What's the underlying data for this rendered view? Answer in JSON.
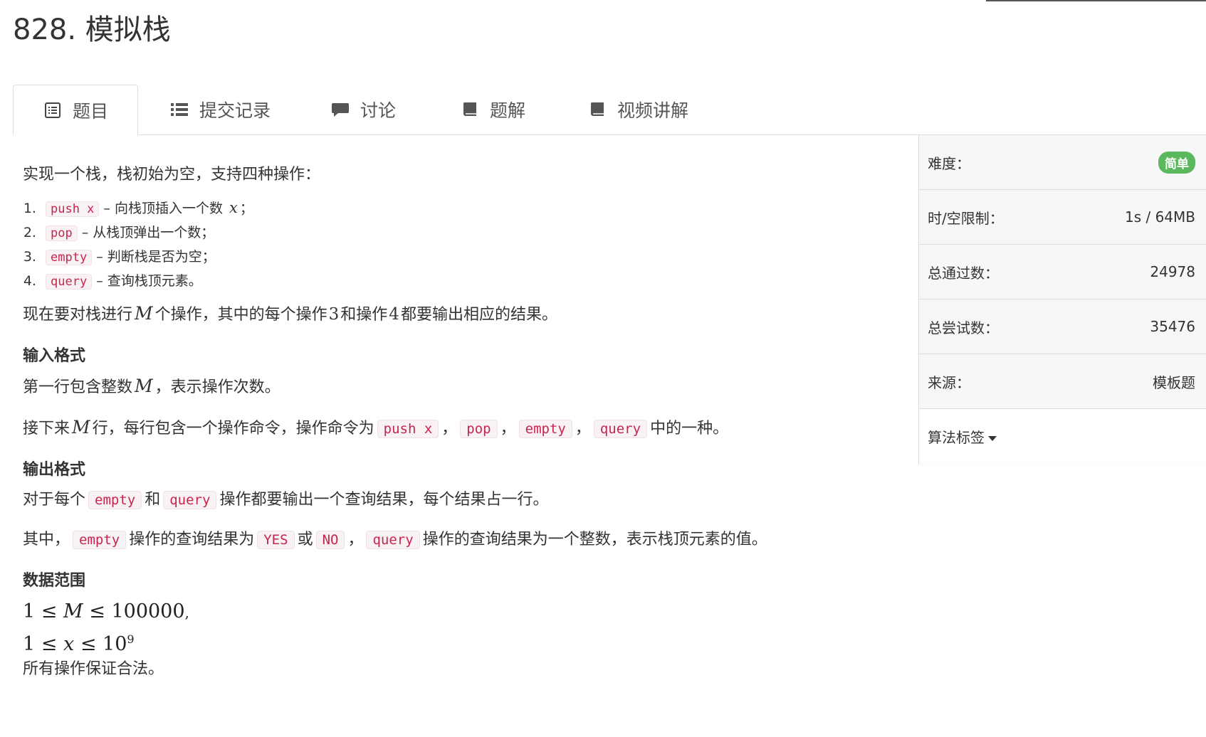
{
  "problem": {
    "title": "828. 模拟栈"
  },
  "tabs": [
    {
      "label": "题目",
      "icon": "list-alt-icon"
    },
    {
      "label": "提交记录",
      "icon": "list-icon"
    },
    {
      "label": "讨论",
      "icon": "comment-icon"
    },
    {
      "label": "题解",
      "icon": "book-icon"
    },
    {
      "label": "视频讲解",
      "icon": "book-icon"
    }
  ],
  "description": {
    "intro": "实现一个栈，栈初始为空，支持四种操作：",
    "ops": [
      {
        "code": "push x",
        "text": "– 向栈顶插入一个数 ",
        "var": "x",
        "end": "；"
      },
      {
        "code": "pop",
        "text": "– 从栈顶弹出一个数；"
      },
      {
        "code": "empty",
        "text": "– 判断栈是否为空；"
      },
      {
        "code": "query",
        "text": "– 查询栈顶元素。"
      }
    ],
    "para1": {
      "a": "现在要对栈进行",
      "m": "M",
      "b": "个操作，其中的每个操作",
      "n3": "3",
      "c": "和操作",
      "n4": "4",
      "d": "都要输出相应的结果。"
    },
    "input_heading": "输入格式",
    "input1": {
      "a": "第一行包含整数",
      "m": "M",
      "b": "，表示操作次数。"
    },
    "input2": {
      "a": "接下来",
      "m": "M",
      "b": "行，每行包含一个操作命令，操作命令为",
      "c1": "push x",
      "s1": "，",
      "c2": "pop",
      "s2": "，",
      "c3": "empty",
      "s3": "，",
      "c4": "query",
      "e": "中的一种。"
    },
    "output_heading": "输出格式",
    "output1": {
      "a": "对于每个",
      "c1": "empty",
      "b": "和",
      "c2": "query",
      "c": "操作都要输出一个查询结果，每个结果占一行。"
    },
    "output2": {
      "a": "其中，",
      "c1": "empty",
      "b": "操作的查询结果为",
      "c2": "YES",
      "c": "或",
      "c3": "NO",
      "d": "，",
      "c4": "query",
      "e": "操作的查询结果为一个整数，表示栈顶元素的值。"
    },
    "range_heading": "数据范围",
    "range1": {
      "lo": "1",
      "rel1": "≤",
      "var": "M",
      "rel2": "≤",
      "hi": "100000",
      "end": ","
    },
    "range2": {
      "lo": "1",
      "rel1": "≤",
      "var": "x",
      "rel2": "≤",
      "base": "10",
      "exp": "9"
    },
    "range3": "所有操作保证合法。"
  },
  "sidebar": {
    "difficulty_label": "难度：",
    "difficulty_value": "简单",
    "limit_label": "时/空限制：",
    "limit_value": "1s / 64MB",
    "passed_label": "总通过数：",
    "passed_value": "24978",
    "tried_label": "总尝试数：",
    "tried_value": "35476",
    "source_label": "来源：",
    "source_value": "模板题",
    "tags_label": "算法标签"
  },
  "colors": {
    "code_text": "#c7254e",
    "code_bg": "#f9f2f4",
    "badge": "#5cb85c"
  }
}
